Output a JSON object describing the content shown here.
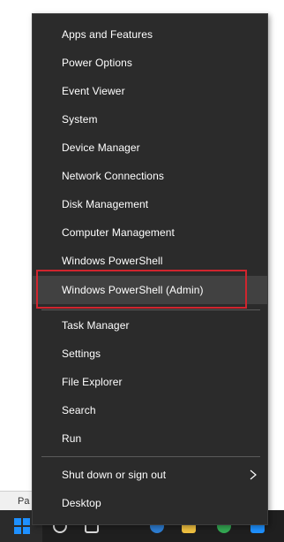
{
  "background_window": {
    "partial_text": "Pa"
  },
  "menu": {
    "items": [
      {
        "label": "Apps and Features"
      },
      {
        "label": "Power Options"
      },
      {
        "label": "Event Viewer"
      },
      {
        "label": "System"
      },
      {
        "label": "Device Manager"
      },
      {
        "label": "Network Connections"
      },
      {
        "label": "Disk Management"
      },
      {
        "label": "Computer Management"
      },
      {
        "label": "Windows PowerShell"
      },
      {
        "label": "Windows PowerShell (Admin)",
        "highlighted": true
      },
      {
        "label": "Task Manager"
      },
      {
        "label": "Settings"
      },
      {
        "label": "File Explorer"
      },
      {
        "label": "Search"
      },
      {
        "label": "Run"
      },
      {
        "label": "Shut down or sign out",
        "has_submenu": true
      },
      {
        "label": "Desktop"
      }
    ]
  },
  "colors": {
    "menu_background": "#2b2b2b",
    "highlight": "#414141",
    "annotation_box": "#d0252e",
    "start_logo": "#1e90ff"
  },
  "icons": {
    "start": "windows-logo-icon",
    "submenu": "chevron-right-icon"
  }
}
